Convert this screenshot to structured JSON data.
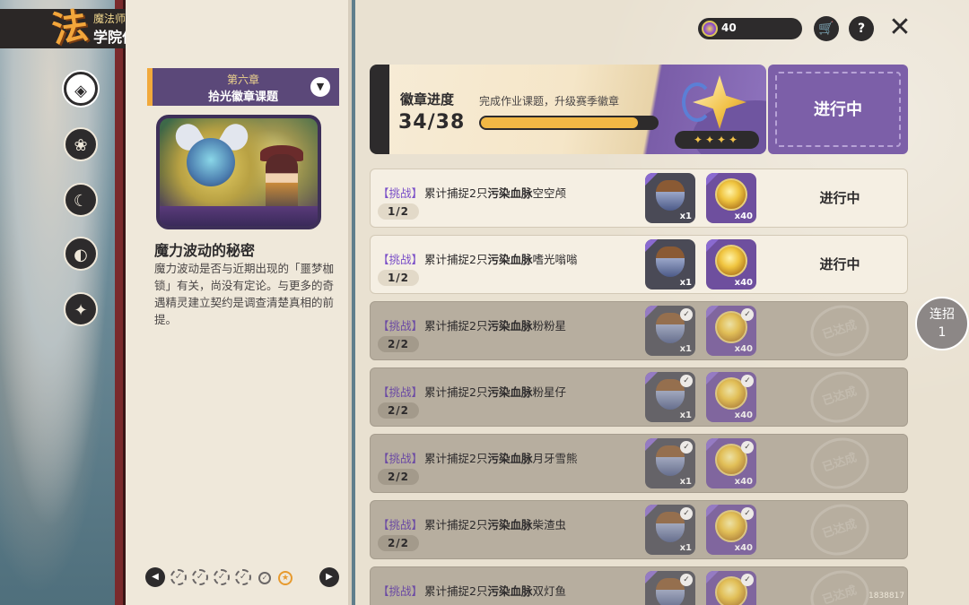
{
  "header": {
    "logo_char": "法",
    "subtitle": "魔法师手册",
    "title": "学院作业"
  },
  "sidebar": {
    "categories": [
      {
        "icon": "compass-book-icon",
        "glyph": "◈",
        "active": true
      },
      {
        "icon": "creature-book-icon",
        "glyph": "❀",
        "active": false
      },
      {
        "icon": "moon-star-icon",
        "glyph": "☾",
        "active": false
      },
      {
        "icon": "crescent-orb-icon",
        "glyph": "◐",
        "active": false
      },
      {
        "icon": "star-ticket-icon",
        "glyph": "✦",
        "active": false
      }
    ]
  },
  "chapter": {
    "number": "第六章",
    "name": "拾光徽章课题",
    "story_title": "魔力波动的秘密",
    "story_desc": "魔力波动是否与近期出现的「噩梦枷锁」有关，尚没有定论。与更多的奇遇精灵建立契约是调查清楚真相的前提。"
  },
  "pager": {
    "prev": "◀",
    "next": "▶"
  },
  "currency": {
    "value": "40"
  },
  "toolbar": {
    "cart_glyph": "🛒",
    "help_glyph": "?",
    "close_glyph": "✕"
  },
  "badge": {
    "label": "徽章进度",
    "hint": "完成作业课题，升级赛季徽章",
    "count": "34/38",
    "progress": 0.895,
    "stars": "✦✦✦✦",
    "status": "进行中"
  },
  "tasks": [
    {
      "tag": "【挑战】",
      "prefix": "累计捕捉2只",
      "key": "污染血脉",
      "target": "空空颅",
      "progress": "1/2",
      "r1_qty": "x1",
      "r2_qty": "x40",
      "status": "进行中",
      "done": false
    },
    {
      "tag": "【挑战】",
      "prefix": "累计捕捉2只",
      "key": "污染血脉",
      "target": "嗜光嗡嗡",
      "progress": "1/2",
      "r1_qty": "x1",
      "r2_qty": "x40",
      "status": "进行中",
      "done": false
    },
    {
      "tag": "【挑战】",
      "prefix": "累计捕捉2只",
      "key": "污染血脉",
      "target": "粉粉星",
      "progress": "2/2",
      "r1_qty": "x1",
      "r2_qty": "x40",
      "status": "已达成",
      "done": true
    },
    {
      "tag": "【挑战】",
      "prefix": "累计捕捉2只",
      "key": "污染血脉",
      "target": "粉星仔",
      "progress": "2/2",
      "r1_qty": "x1",
      "r2_qty": "x40",
      "status": "已达成",
      "done": true
    },
    {
      "tag": "【挑战】",
      "prefix": "累计捕捉2只",
      "key": "污染血脉",
      "target": "月牙雪熊",
      "progress": "2/2",
      "r1_qty": "x1",
      "r2_qty": "x40",
      "status": "已达成",
      "done": true
    },
    {
      "tag": "【挑战】",
      "prefix": "累计捕捉2只",
      "key": "污染血脉",
      "target": "柴渣虫",
      "progress": "2/2",
      "r1_qty": "x1",
      "r2_qty": "x40",
      "status": "已达成",
      "done": true
    },
    {
      "tag": "【挑战】",
      "prefix": "累计捕捉2只",
      "key": "污染血脉",
      "target": "双灯鱼",
      "progress": "",
      "r1_qty": "",
      "r2_qty": "",
      "status": "已达成",
      "done": true
    }
  ],
  "combo": {
    "label": "连招",
    "count": "1"
  },
  "build_id": "1838817"
}
